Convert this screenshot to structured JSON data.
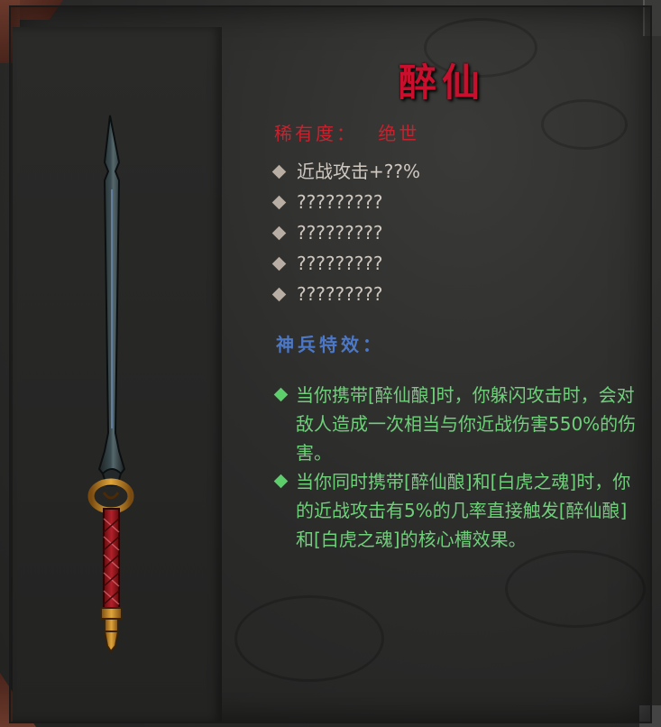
{
  "item": {
    "name": "醉仙",
    "rarity_label": "稀有度：",
    "rarity_value": "绝世",
    "stats": [
      "近战攻击+??%",
      "?????????",
      "?????????",
      "?????????",
      "?????????"
    ]
  },
  "special": {
    "header": "神兵特效：",
    "effects": [
      "当你携带[醉仙酿]时，你躲闪攻击时，会对敌人造成一次相当与你近战伤害550%的伤害。",
      "当你同时携带[醉仙酿]和[白虎之魂]时，你的近战攻击有5%的几率直接触发[醉仙酿]和[白虎之魂]的核心槽效果。"
    ]
  },
  "colors": {
    "title": "#c8102e",
    "rarity": "#c8222e",
    "stat_text": "#cfc8c0",
    "section_header": "#4c78c8",
    "effect_text": "#6fd07a"
  },
  "icons": [
    "sword-item-icon",
    "gray-diamond-bullet-icon",
    "green-diamond-bullet-icon"
  ]
}
